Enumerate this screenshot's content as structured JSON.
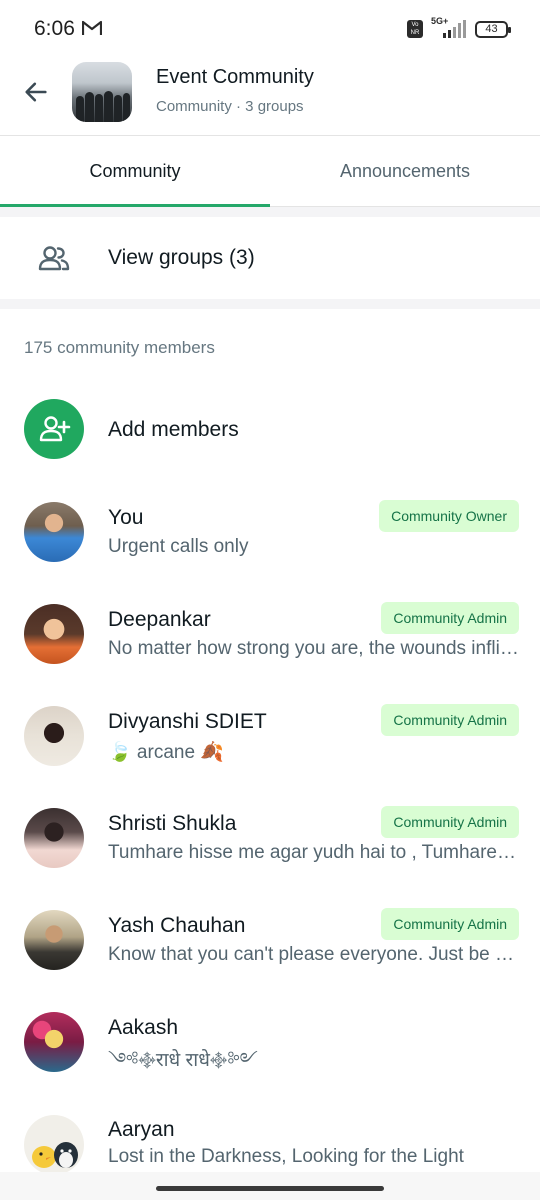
{
  "status_bar": {
    "time": "6:06",
    "network": "5G+",
    "battery": "43"
  },
  "header": {
    "title": "Event Community",
    "subtitle": "Community · 3 groups"
  },
  "tabs": [
    {
      "label": "Community",
      "active": true
    },
    {
      "label": "Announcements",
      "active": false
    }
  ],
  "view_groups": {
    "label": "View groups (3)"
  },
  "members_section": {
    "count_label": "175 community members",
    "add_label": "Add members"
  },
  "members": [
    {
      "name": "You",
      "about": "Urgent calls only",
      "badge": "Community Owner"
    },
    {
      "name": "Deepankar",
      "about": "No matter how strong you are, the wounds inflicted by your loved ones will always hurt you",
      "badge": "Community Admin"
    },
    {
      "name": "Divyanshi SDIET",
      "about": "🍃 arcane 🍂",
      "badge": "Community Admin"
    },
    {
      "name": "Shristi Shukla",
      "about": "Tumhare hisse me agar yudh hai to , Tumhare hisse me",
      "badge": "Community Admin"
    },
    {
      "name": "Yash Chauhan",
      "about": "Know that you can't please everyone. Just be yourself",
      "badge": "Community Admin"
    },
    {
      "name": "Aakash",
      "about": "༺࿇राधे राधे࿇༻",
      "badge": ""
    },
    {
      "name": "Aaryan",
      "about": "Lost in the Darkness, Looking for the Light",
      "badge": ""
    }
  ],
  "colors": {
    "accent": "#25a86a",
    "badge_bg": "#d9fdd3",
    "badge_text": "#157347",
    "secondary_text": "#667781"
  }
}
